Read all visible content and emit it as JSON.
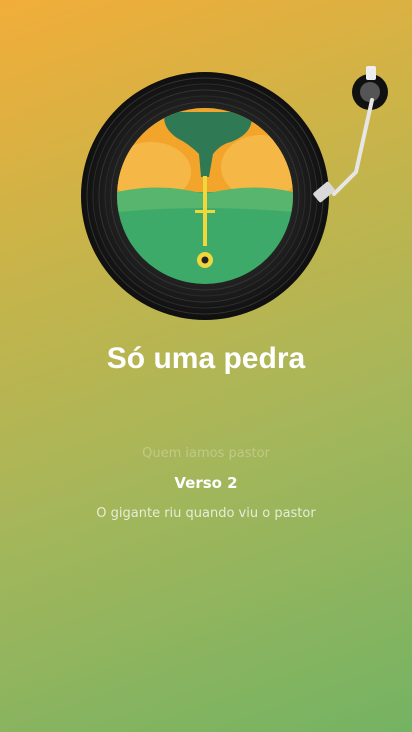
{
  "player": {
    "song_title": "Só uma pedra",
    "icons": {
      "record": "vinyl-record-icon",
      "tonearm": "tonearm-icon",
      "cover": "album-cover-art"
    },
    "colors": {
      "text": "#ffffff",
      "vinyl": "#1c1c1c",
      "cover_sky": "#f3a52b",
      "cover_grass": "#3eaa6a",
      "cover_tree": "#2f7a55"
    }
  },
  "lyrics": {
    "previous": "Quem iamos pastor",
    "current": "Verso 2",
    "next": "O gigante riu quando viu o pastor"
  }
}
